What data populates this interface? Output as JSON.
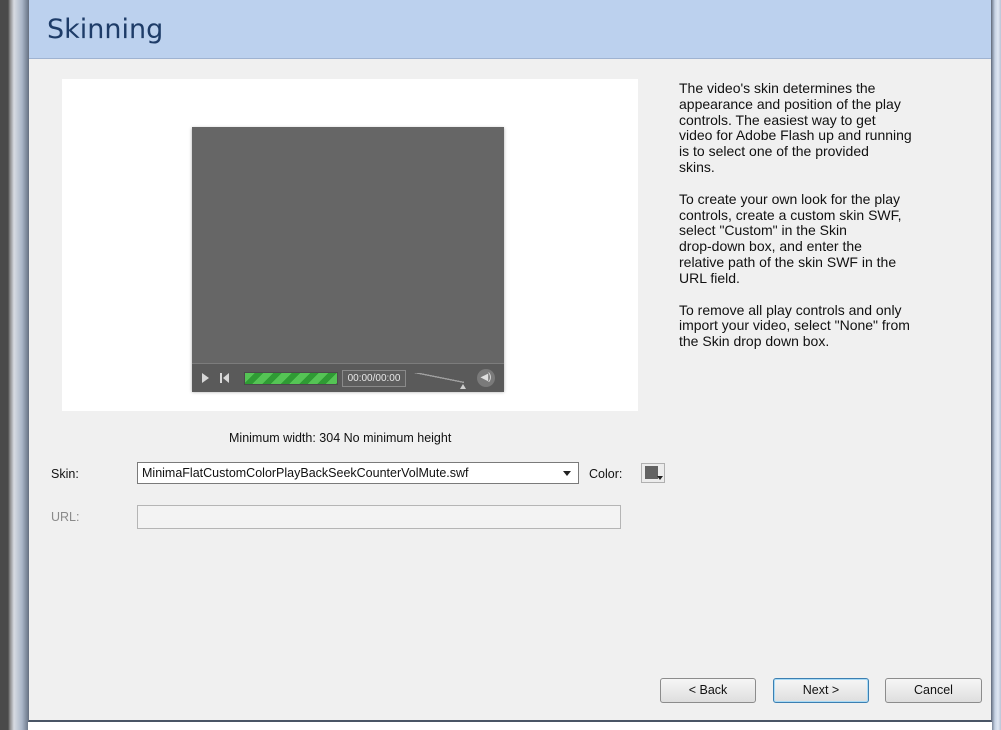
{
  "header": {
    "title": "Skinning"
  },
  "description": {
    "paragraphs": [
      "The video's skin determines the\nappearance and position of the play\ncontrols.  The easiest way to get\nvideo for Adobe Flash up and running\nis to select one of the provided\nskins.",
      "To create your own look for the play\ncontrols, create a custom skin SWF,\nselect \"Custom\" in the Skin\ndrop-down box, and enter the\nrelative path of the skin SWF in the\nURL field.",
      "To remove all play controls and only\nimport your video, select \"None\" from\nthe Skin drop down box."
    ]
  },
  "preview": {
    "counter": "00:00/00:00",
    "seek_color": "#55c455"
  },
  "min_size_text": "Minimum width: 304   No minimum height",
  "form": {
    "skin_label": "Skin:",
    "skin_value": "MinimaFlatCustomColorPlayBackSeekCounterVolMute.swf",
    "color_label": "Color:",
    "color_value": "#626262",
    "url_label": "URL:",
    "url_value": ""
  },
  "buttons": {
    "back": "< Back",
    "next": "Next >",
    "cancel": "Cancel"
  },
  "colors": {
    "header_bg": "#bcd1ee",
    "header_text": "#1e3c68",
    "dialog_bg": "#f0f0f0"
  }
}
